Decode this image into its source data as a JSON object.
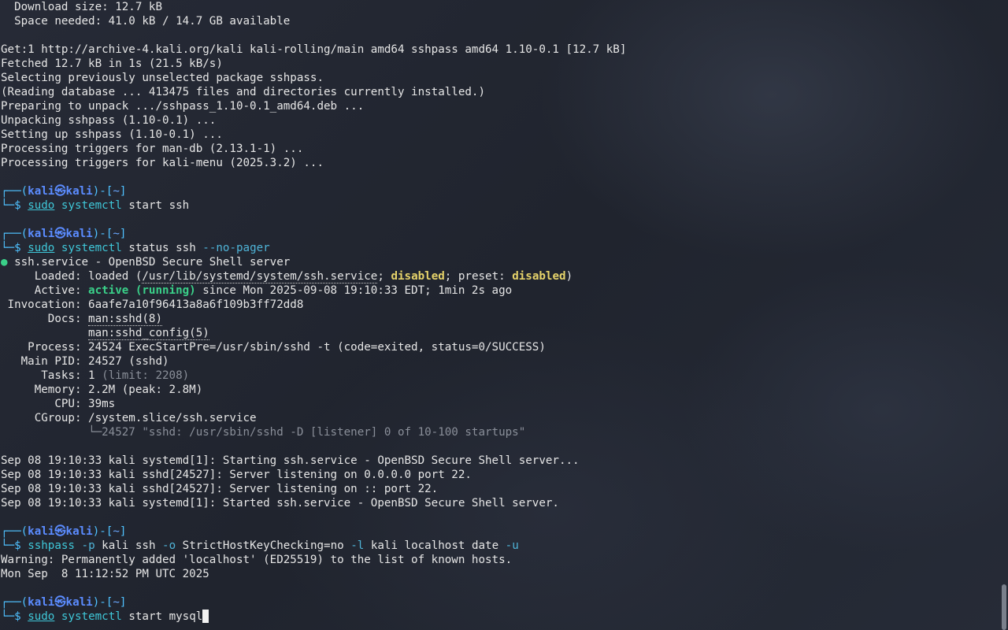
{
  "terminal": {
    "download_size": "  Download size: 12.7 kB",
    "space_needed": "  Space needed: 41.0 kB / 14.7 GB available",
    "get1": "Get:1 http://archive-4.kali.org/kali kali-rolling/main amd64 sshpass amd64 1.10-0.1 [12.7 kB]",
    "fetched": "Fetched 12.7 kB in 1s (21.5 kB/s)",
    "selecting": "Selecting previously unselected package sshpass.",
    "reading_db": "(Reading database ... 413475 files and directories currently installed.)",
    "preparing": "Preparing to unpack .../sshpass_1.10-0.1_amd64.deb ...",
    "unpacking": "Unpacking sshpass (1.10-0.1) ...",
    "setting_up": "Setting up sshpass (1.10-0.1) ...",
    "trig_mandb": "Processing triggers for man-db (2.13.1-1) ...",
    "trig_kalimenu": "Processing triggers for kali-menu (2025.3.2) ...",
    "prompt": {
      "open": "┌──(",
      "user": "kali",
      "at": "㉿",
      "host": "kali",
      "mid": ")-[",
      "dir": "~",
      "close": "]",
      "dollar_prefix": "└─",
      "dollar": "$ "
    },
    "cmd1": {
      "sudo": "sudo",
      "prog": "systemctl",
      "rest": " start ssh"
    },
    "cmd2": {
      "sudo": "sudo",
      "prog": "systemctl",
      "rest": " status ssh ",
      "opt": "--no-pager"
    },
    "status": {
      "bullet": "●",
      "title": " ssh.service - OpenBSD Secure Shell server",
      "loaded_label": "     Loaded: ",
      "loaded_a": "loaded (",
      "loaded_path": "/usr/lib/systemd/system/ssh.service",
      "loaded_b": "; ",
      "loaded_disabled": "disabled",
      "loaded_c": "; preset: ",
      "loaded_preset": "disabled",
      "loaded_d": ")",
      "active_label": "     Active: ",
      "active_state": "active (running)",
      "active_rest": " since Mon 2025-09-08 19:10:33 EDT; 1min 2s ago",
      "invocation_label": " Invocation: ",
      "invocation": "6aafe7a10f96413a8a6f109b3ff72dd8",
      "docs_label": "       Docs: ",
      "docs1": "man:sshd(8)",
      "docs_pad": "             ",
      "docs2": "man:sshd_config(5)",
      "process_label": "    Process: ",
      "process": "24524 ExecStartPre=/usr/sbin/sshd -t (code=exited, status=0/SUCCESS)",
      "mainpid_label": "   Main PID: ",
      "mainpid": "24527 (sshd)",
      "tasks_label": "      Tasks: ",
      "tasks": "1",
      "tasks_limit": " (limit: 2208)",
      "memory_label": "     Memory: ",
      "memory": "2.2M (peak: 2.8M)",
      "cpu_label": "        CPU: ",
      "cpu": "39ms",
      "cgroup_label": "     CGroup: ",
      "cgroup": "/system.slice/ssh.service",
      "cgroup_child_pad": "             ",
      "cgroup_child": "└─24527 \"sshd: /usr/sbin/sshd -D [listener] 0 of 10-100 startups\""
    },
    "log1": "Sep 08 19:10:33 kali systemd[1]: Starting ssh.service - OpenBSD Secure Shell server...",
    "log2": "Sep 08 19:10:33 kali sshd[24527]: Server listening on 0.0.0.0 port 22.",
    "log3": "Sep 08 19:10:33 kali sshd[24527]: Server listening on :: port 22.",
    "log4": "Sep 08 19:10:33 kali systemd[1]: Started ssh.service - OpenBSD Secure Shell server.",
    "cmd3": {
      "prog": "sshpass",
      "opt_p": " -p",
      "a": " kali ssh",
      "opt_o": " -o",
      "b": " StrictHostKeyChecking=no",
      "opt_l": " -l",
      "c": " kali localhost date",
      "opt_u": " -u"
    },
    "warning": "Warning: Permanently added 'localhost' (ED25519) to the list of known hosts.",
    "date_out": "Mon Sep  8 11:12:52 PM UTC 2025",
    "cmd4": {
      "sudo": "sudo",
      "prog": "systemctl",
      "rest": " start mysql"
    }
  },
  "colors": {
    "prompt_frame": "#4fc1ff",
    "prompt_user": "#5b8cff",
    "command": "#3fc7d8",
    "warning_yellow": "#e6d36a",
    "active_green": "#3ad089"
  }
}
